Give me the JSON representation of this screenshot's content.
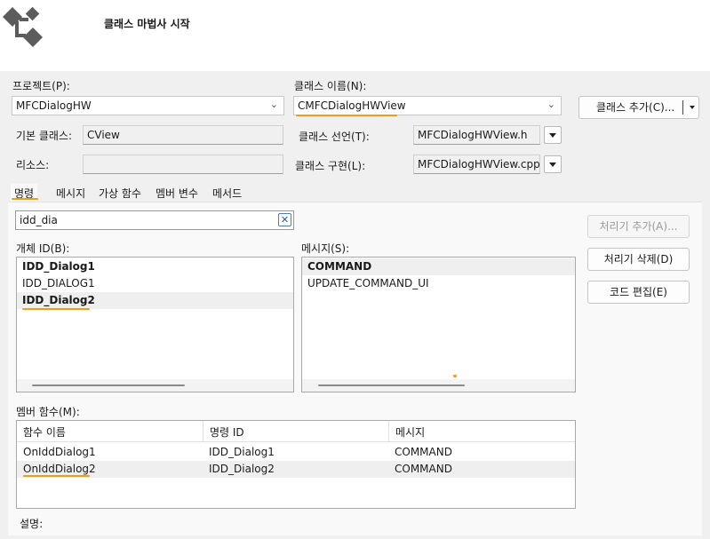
{
  "header": {
    "title": "클래스 마법사 시작"
  },
  "project": {
    "label": "프로젝트(P):",
    "value": "MFCDialogHW"
  },
  "class_name": {
    "label": "클래스 이름(N):",
    "value": "CMFCDialogHWView"
  },
  "add_class_button": "클래스 추가(C)...",
  "base_class": {
    "label": "기본 클래스:",
    "value": "CView"
  },
  "resource": {
    "label": "리소스:",
    "value": ""
  },
  "class_declaration": {
    "label": "클래스 선언(T):",
    "value": "MFCDialogHWView.h"
  },
  "class_implementation": {
    "label": "클래스 구현(L):",
    "value": "MFCDialogHWView.cpp"
  },
  "tabs": [
    {
      "label": "명령",
      "active": true
    },
    {
      "label": "메시지"
    },
    {
      "label": "가상 함수"
    },
    {
      "label": "멤버 변수"
    },
    {
      "label": "메서드"
    }
  ],
  "search": {
    "value": "idd_dia",
    "clear_glyph": "✕"
  },
  "object_ids": {
    "label": "개체 ID(B):",
    "items": [
      {
        "text": "IDD_Dialog1",
        "bold": true
      },
      {
        "text": "IDD_DIALOG1",
        "bold": false
      },
      {
        "text": "IDD_Dialog2",
        "bold": true,
        "selected": true
      }
    ]
  },
  "messages": {
    "label": "메시지(S):",
    "items": [
      {
        "text": "COMMAND",
        "bold": true,
        "selected": true
      },
      {
        "text": "UPDATE_COMMAND_UI",
        "bold": false
      }
    ]
  },
  "handler_buttons": {
    "add": "처리기 추가(A)...",
    "delete": "처리기 삭제(D)",
    "edit": "코드 편집(E)"
  },
  "member_functions": {
    "label": "멤버 함수(M):",
    "columns": [
      "함수 이름",
      "명령 ID",
      "메시지"
    ],
    "rows": [
      [
        "OnIddDialog1",
        "IDD_Dialog1",
        "COMMAND"
      ],
      [
        "OnIddDialog2",
        "IDD_Dialog2",
        "COMMAND"
      ]
    ]
  },
  "description": {
    "label": "설명:"
  },
  "colors": {
    "accent_underline": "#f39c12",
    "icon": "#5c5c5c"
  }
}
